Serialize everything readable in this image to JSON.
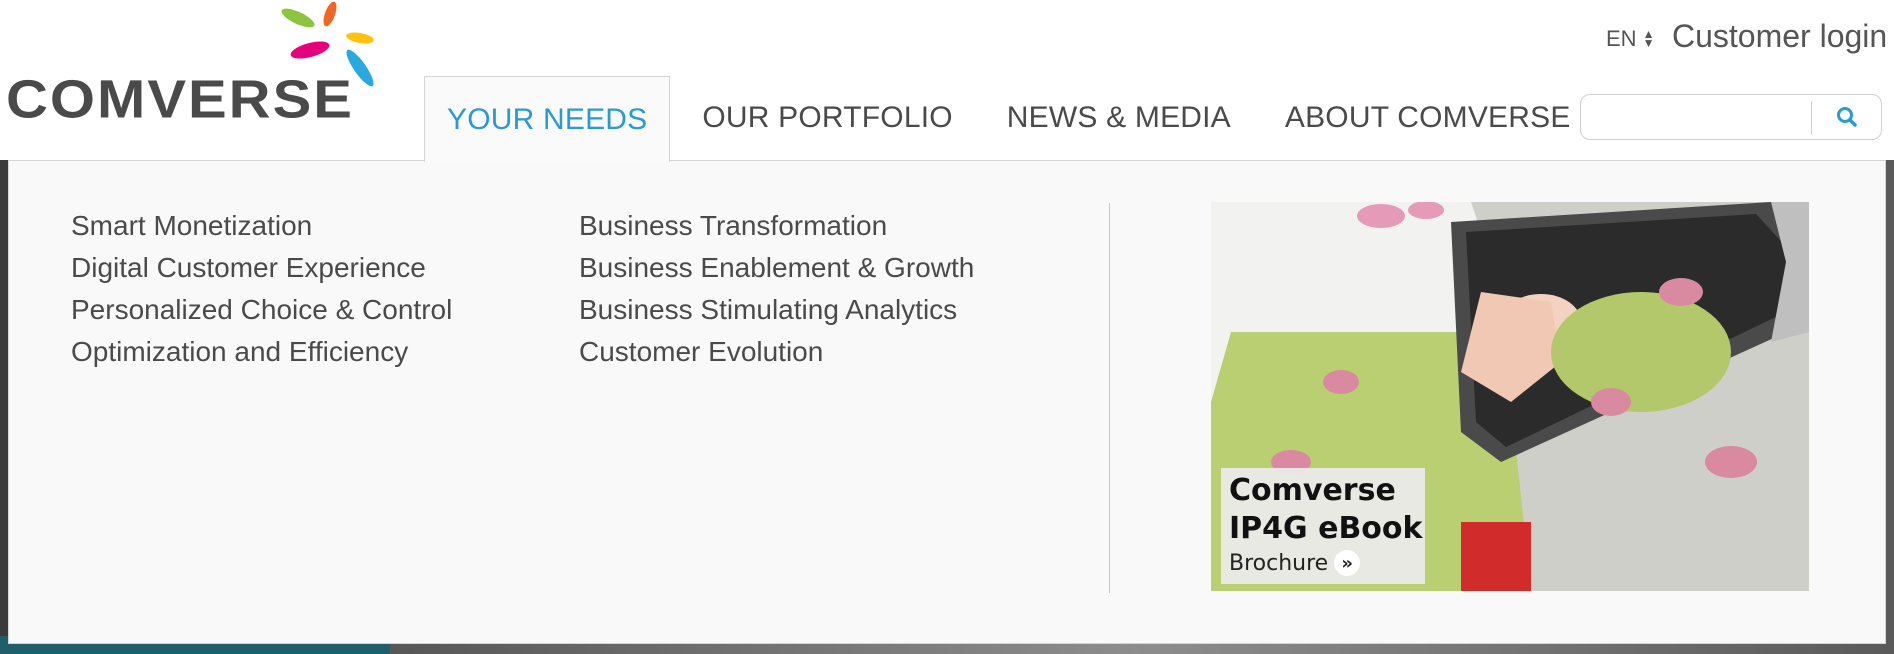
{
  "brand": {
    "name": "COMVERSE"
  },
  "topbar": {
    "language": "EN",
    "customer_login": "Customer login"
  },
  "nav": [
    {
      "label": "YOUR NEEDS"
    },
    {
      "label": "OUR PORTFOLIO"
    },
    {
      "label": "NEWS & MEDIA"
    },
    {
      "label": "ABOUT COMVERSE"
    }
  ],
  "nav_active_index": 0,
  "search": {
    "value": "",
    "placeholder": "",
    "icon": "search-icon"
  },
  "dropdown": {
    "column_1": [
      "Smart Monetization",
      "Digital Customer Experience",
      "Personalized Choice & Control",
      "Optimization and Efficiency"
    ],
    "column_2": [
      "Business Transformation",
      "Business Enablement & Growth",
      "Business Stimulating Analytics",
      "Customer Evolution"
    ],
    "promo": {
      "title_line_1": "Comverse",
      "title_line_2": "IP4G eBook",
      "cta": "Brochure",
      "cta_icon": "double-chevron-right-icon"
    }
  },
  "colors": {
    "accent": "#2a9ad3",
    "nav_text": "#4a4a4a",
    "logo_leaf_green": "#8cc63f",
    "logo_leaf_orange": "#f26522",
    "logo_leaf_yellow": "#ffc20e",
    "logo_leaf_pink": "#e6007e",
    "logo_leaf_blue": "#29a9e0"
  }
}
